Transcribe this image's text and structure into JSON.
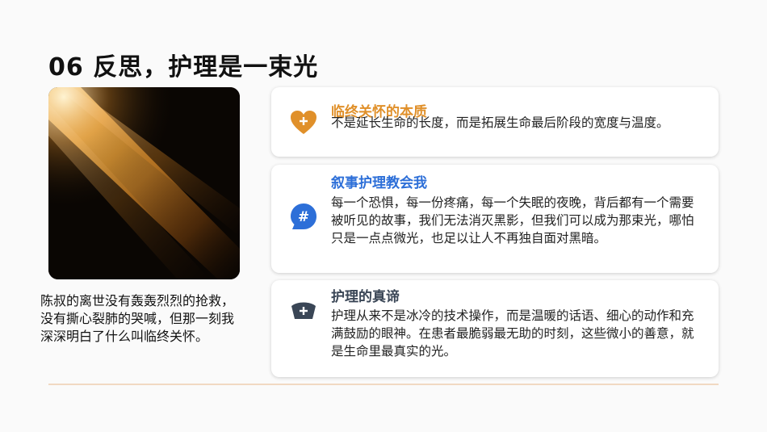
{
  "slide": {
    "title": "06  反思，护理是一束光",
    "caption": "陈叔的离世没有轰轰烈烈的抢救，没有撕心裂肺的哭喊，但那一刻我深深明白了什么叫临终关怀。"
  },
  "cards": [
    {
      "heading": "临终关怀的本质",
      "heading_color": "#e0902a",
      "icon": "heart-plus-icon",
      "body": "不是延长生命的长度，而是拓展生命最后阶段的宽度与温度。"
    },
    {
      "heading": "叙事护理教会我",
      "heading_color": "#2d6fd8",
      "icon": "hashtag-chat-icon",
      "body": "每一个恐惧，每一份疼痛，每一个失眠的夜晚，背后都有一个需要被听见的故事，我们无法消灭黑影，但我们可以成为那束光，哪怕只是一点点微光，也足以让人不再独自面对黑暗。"
    },
    {
      "heading": "护理的真谛",
      "heading_color": "#3a4656",
      "icon": "nurse-cap-icon",
      "body": "护理从来不是冰冷的技术操作，而是温暖的话语、细心的动作和充满鼓励的眼神。在患者最脆弱最无助的时刻，这些微小的善意，就是生命里最真实的光。"
    }
  ]
}
